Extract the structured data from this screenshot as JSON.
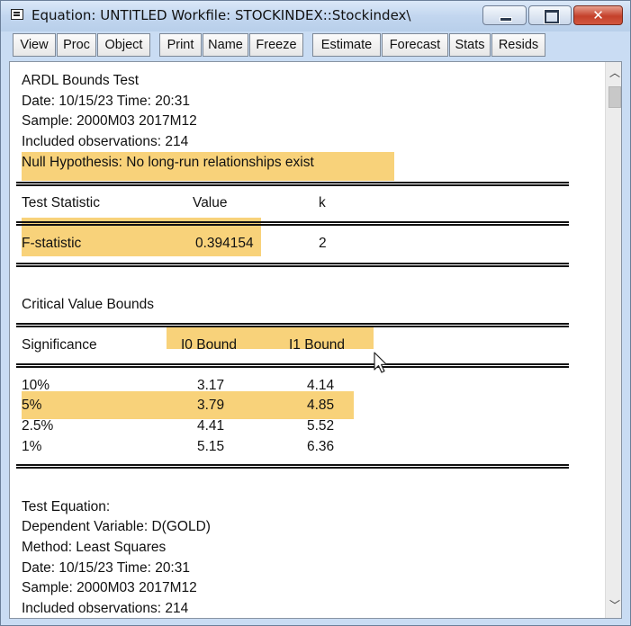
{
  "window": {
    "title": "Equation: UNTITLED   Workfile: STOCKINDEX::Stockindex\\",
    "close_glyph": "✕"
  },
  "toolbar": [
    "View",
    "Proc",
    "Object",
    "Print",
    "Name",
    "Freeze",
    "Estimate",
    "Forecast",
    "Stats",
    "Resids"
  ],
  "output": {
    "heading": "ARDL Bounds Test",
    "date_line": "Date: 10/15/23   Time: 20:31",
    "sample_line": "Sample: 2000M03 2017M12",
    "obs_line": "Included observations: 214",
    "null_hypothesis": "Null Hypothesis: No long-run relationships exist",
    "stat_table": {
      "headers": [
        "Test Statistic",
        "Value",
        "k"
      ],
      "row": [
        "F-statistic",
        "0.394154",
        "2"
      ]
    },
    "critical_title": "Critical Value Bounds",
    "critical_table": {
      "headers": [
        "Significance",
        "I0 Bound",
        "I1 Bound"
      ],
      "rows": [
        [
          "10%",
          "3.17",
          "4.14"
        ],
        [
          "5%",
          "3.79",
          "4.85"
        ],
        [
          "2.5%",
          "4.41",
          "5.52"
        ],
        [
          "1%",
          "5.15",
          "6.36"
        ]
      ]
    },
    "test_equation": {
      "title": "Test Equation:",
      "dependent": "Dependent Variable: D(GOLD)",
      "method": "Method: Least Squares",
      "date_line": "Date: 10/15/23   Time: 20:31",
      "sample_line": "Sample: 2000M03 2017M12",
      "obs_line": "Included observations: 214"
    }
  },
  "colors": {
    "highlight": "#f8d27a",
    "titlebar": "#c2d6ef"
  }
}
